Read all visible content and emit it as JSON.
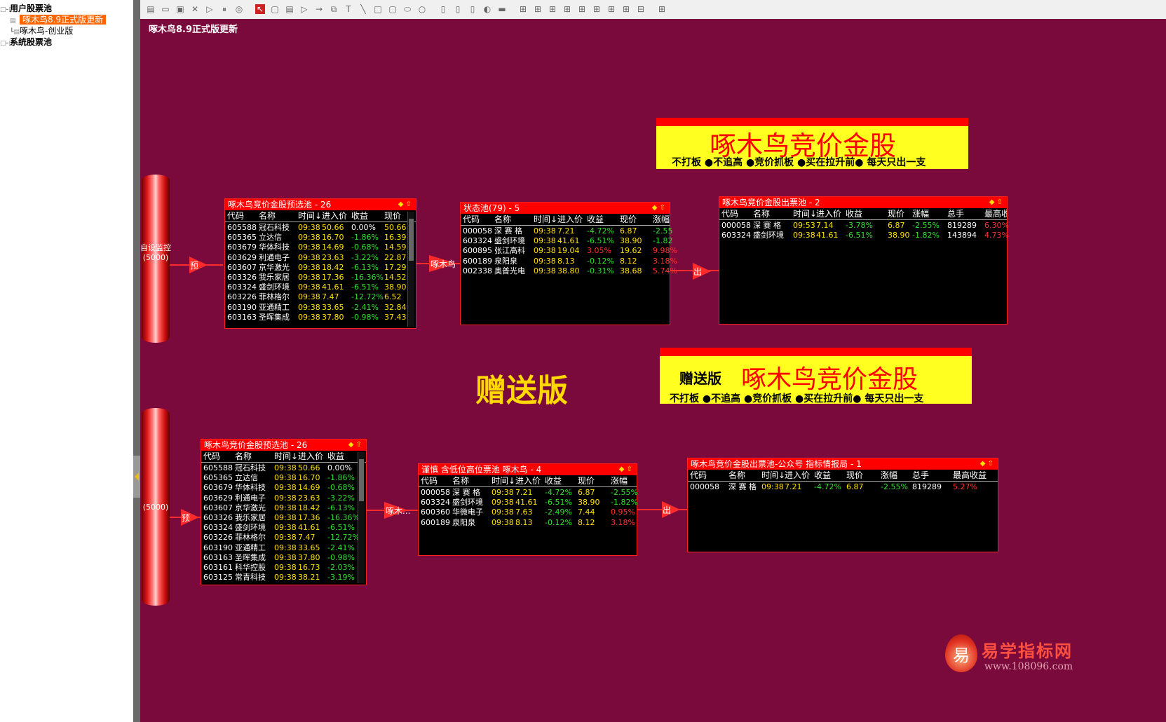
{
  "tree": {
    "items": [
      {
        "label": "用户股票池",
        "lines": "□-□",
        "bold": true
      },
      {
        "label": "啄木鸟8.9正式版更新",
        "lines": "  ▤",
        "selected": true
      },
      {
        "label": "啄木鸟-创业版",
        "lines": " ┗▤"
      },
      {
        "label": "系统股票池",
        "lines": "□-□",
        "bold": true
      }
    ]
  },
  "toolbar": {
    "icons": [
      "new-icon",
      "open-icon",
      "save-icon",
      "delete-icon",
      "play-icon",
      "pause-icon",
      "stop-icon",
      "pointer-icon",
      "select-icon",
      "list-icon",
      "triangle-icon",
      "arrow-icon",
      "group-icon",
      "text-icon",
      "line-icon",
      "rect-icon",
      "roundrect-icon",
      "ellipse-icon",
      "circle-icon",
      "copy-icon",
      "paste-icon",
      "trash-icon",
      "fill-icon",
      "linestyle-icon",
      "align-left-icon",
      "align-center-icon",
      "align-right-icon",
      "align-top-icon",
      "align-middle-icon",
      "align-bottom-icon",
      "distribute-h-icon",
      "distribute-v-icon",
      "size-icon",
      "lock-icon"
    ]
  },
  "canvas": {
    "title": "啄木鸟8.9正式版更新"
  },
  "top": {
    "cylinder_label": "自设监控\n(5000)",
    "flow_labels": [
      "预",
      "啄木鸟",
      "出"
    ],
    "pool_pre": {
      "title": "啄木鸟竞价金股预选池 - 26",
      "cols": [
        "代码",
        "名称",
        "时间↓",
        "进入价",
        "收益",
        "现价"
      ],
      "rows": [
        [
          "605588",
          "冠石科技",
          "09:38",
          "50.66",
          "0.00%",
          "50.66"
        ],
        [
          "605365",
          "立达信",
          "09:38",
          "16.70",
          "-1.86%",
          "16.39"
        ],
        [
          "603679",
          "华体科技",
          "09:38",
          "14.69",
          "-0.68%",
          "14.59"
        ],
        [
          "603629",
          "利通电子",
          "09:38",
          "23.63",
          "-3.22%",
          "22.87"
        ],
        [
          "603607",
          "京华激光",
          "09:38",
          "18.42",
          "-6.13%",
          "17.29"
        ],
        [
          "603326",
          "我乐家居",
          "09:38",
          "17.36",
          "-16.36%",
          "14.52"
        ],
        [
          "603324",
          "盛剑环境",
          "09:38",
          "41.61",
          "-6.51%",
          "38.90"
        ],
        [
          "603226",
          "菲林格尔",
          "09:38",
          "7.47",
          "-12.72%",
          "6.52"
        ],
        [
          "603190",
          "亚通精工",
          "09:38",
          "33.65",
          "-2.41%",
          "32.84"
        ],
        [
          "603163",
          "圣晖集成",
          "09:38",
          "37.80",
          "-0.98%",
          "37.43"
        ]
      ]
    },
    "pool_state": {
      "title": "状态池(79) - 5",
      "cols": [
        "代码",
        "名称",
        "时间↓",
        "进入价",
        "收益",
        "现价",
        "涨幅"
      ],
      "rows": [
        [
          "000058",
          "深 赛 格",
          "09:38",
          "7.21",
          "-4.72%",
          "6.87",
          "-2.55"
        ],
        [
          "603324",
          "盛剑环境",
          "09:38",
          "41.61",
          "-6.51%",
          "38.90",
          "-1.82"
        ],
        [
          "600895",
          "张江高科",
          "09:38",
          "19.04",
          "3.05%",
          "19.62",
          "9.98%"
        ],
        [
          "600189",
          "泉阳泉",
          "09:38",
          "8.13",
          "-0.12%",
          "8.12",
          "3.18%"
        ],
        [
          "002338",
          "奥普光电",
          "09:38",
          "38.80",
          "-0.31%",
          "38.68",
          "5.74%"
        ]
      ]
    },
    "pool_out": {
      "title": "啄木鸟竞价金股出票池 - 2",
      "cols": [
        "代码",
        "名称",
        "时间↓",
        "进入价",
        "收益",
        "现价",
        "涨幅",
        "总手",
        "最高收"
      ],
      "rows": [
        [
          "000058",
          "深 赛 格",
          "09:53",
          "7.14",
          "-3.78%",
          "6.87",
          "-2.55%",
          "819289",
          "6.30%"
        ],
        [
          "603324",
          "盛剑环境",
          "09:38",
          "41.61",
          "-6.51%",
          "38.90",
          "-1.82%",
          "143894",
          "4.73%"
        ]
      ]
    },
    "banner": {
      "title": "啄木鸟竞价金股",
      "subtitle": "不打板 ●不追高 ●竞价抓板 ●买在拉升前● 每天只出一支"
    }
  },
  "gift_label": "赠送版",
  "bottom": {
    "cylinder_label": "(5000)",
    "flow_labels": [
      "预",
      "啄木...",
      "出"
    ],
    "pool_pre": {
      "title": "啄木鸟竞价金股预选池 - 26",
      "cols": [
        "代码",
        "名称",
        "时间↓",
        "进入价",
        "收益"
      ],
      "rows": [
        [
          "605588",
          "冠石科技",
          "09:38",
          "50.66",
          "0.00%"
        ],
        [
          "605365",
          "立达信",
          "09:38",
          "16.70",
          "-1.86%"
        ],
        [
          "603679",
          "华体科技",
          "09:38",
          "14.69",
          "-0.68%"
        ],
        [
          "603629",
          "利通电子",
          "09:38",
          "23.63",
          "-3.22%"
        ],
        [
          "603607",
          "京华激光",
          "09:38",
          "18.42",
          "-6.13%"
        ],
        [
          "603326",
          "我乐家居",
          "09:38",
          "17.36",
          "-16.36%"
        ],
        [
          "603324",
          "盛剑环境",
          "09:38",
          "41.61",
          "-6.51%"
        ],
        [
          "603226",
          "菲林格尔",
          "09:38",
          "7.47",
          "-12.72%"
        ],
        [
          "603190",
          "亚通精工",
          "09:38",
          "33.65",
          "-2.41%"
        ],
        [
          "603163",
          "圣晖集成",
          "09:38",
          "37.80",
          "-0.98%"
        ],
        [
          "603161",
          "科华控股",
          "09:38",
          "16.73",
          "-2.03%"
        ],
        [
          "603125",
          "常青科技",
          "09:38",
          "38.21",
          "-3.19%"
        ]
      ]
    },
    "pool_state": {
      "title": "谨慎 含低位高位票池 啄木鸟 - 4",
      "cols": [
        "代码",
        "名称",
        "时间↓",
        "进入价",
        "收益",
        "现价",
        "涨幅"
      ],
      "rows": [
        [
          "000058",
          "深 赛 格",
          "09:38",
          "7.21",
          "-4.72%",
          "6.87",
          "-2.55%"
        ],
        [
          "603324",
          "盛剑环境",
          "09:38",
          "41.61",
          "-6.51%",
          "38.90",
          "-1.82%"
        ],
        [
          "600360",
          "华微电子",
          "09:38",
          "7.63",
          "-2.49%",
          "7.44",
          "0.95%"
        ],
        [
          "600189",
          "泉阳泉",
          "09:38",
          "8.13",
          "-0.12%",
          "8.12",
          "3.18%"
        ]
      ]
    },
    "pool_out": {
      "title": "啄木鸟竞价金股出票池-公众号 指标情报局 - 1",
      "cols": [
        "代码",
        "名称",
        "时间↓",
        "进入价",
        "收益",
        "现价",
        "涨幅",
        "总手",
        "最高收益"
      ],
      "rows": [
        [
          "000058",
          "深 赛 格",
          "09:38",
          "7.21",
          "-4.72%",
          "6.87",
          "-2.55%",
          "819289",
          "5.27%"
        ]
      ]
    },
    "banner": {
      "tag": "赠送版",
      "title": "啄木鸟竞价金股",
      "subtitle": "不打板 ●不追高 ●竞价抓板 ●买在拉升前● 每天只出一支"
    }
  },
  "watermark": {
    "logo": "易",
    "name": "易学指标网",
    "url": "www.108096.com"
  },
  "colors": {
    "canvas": "#7a0a3c",
    "pool_header": "#ff0000",
    "up": "#ff3030",
    "down": "#30e030",
    "text": "#ffffff",
    "code": "#ffffff",
    "price": "#ffe000"
  }
}
